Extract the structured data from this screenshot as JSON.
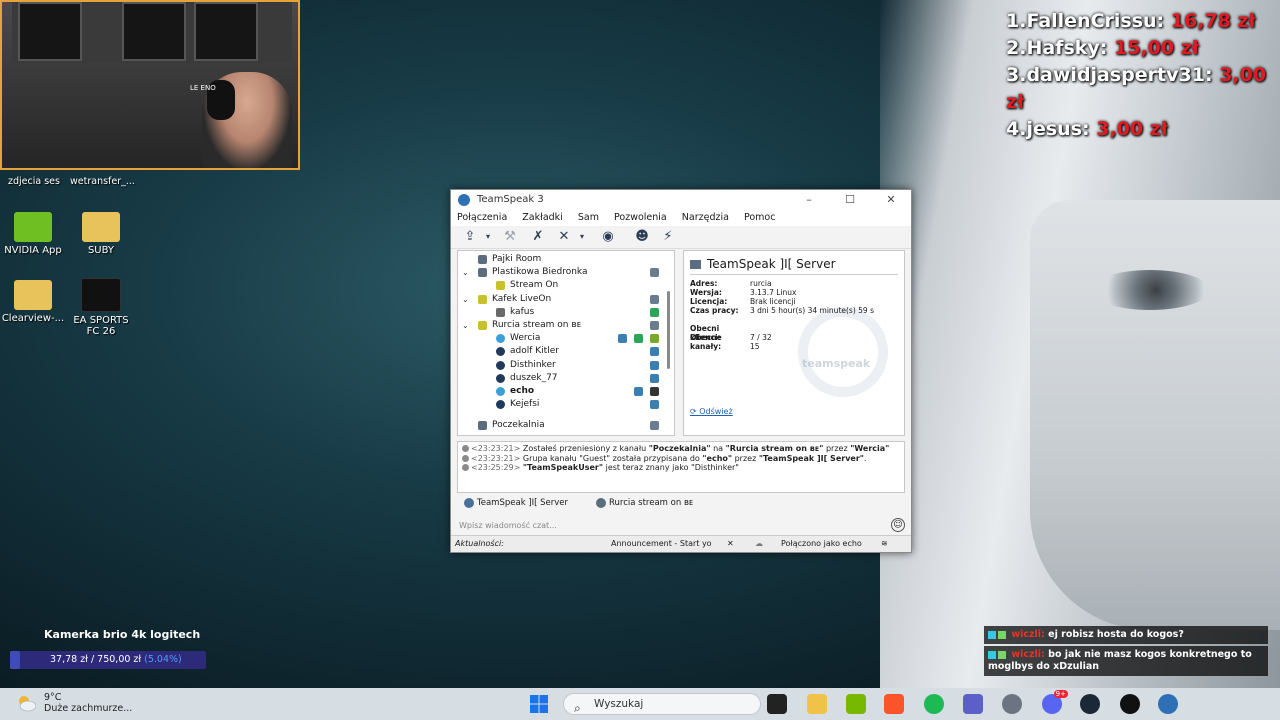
{
  "desktop": {
    "webcam_overlay": {
      "tag": "LE  ENO"
    },
    "file_labels": [
      "zdjecia ses",
      "wetransfer_..."
    ],
    "icons": [
      {
        "label": "NVIDIA App",
        "color": "#6fbf22"
      },
      {
        "label": "SUBY",
        "color": "#e8c25a"
      },
      {
        "label": "Clearview-...",
        "color": "#e8c25a"
      },
      {
        "label": "EA SPORTS FC 26",
        "color": "#111111"
      }
    ]
  },
  "donations": [
    {
      "rank": "1.",
      "name": "FallenCrissu:",
      "amount": "16,78 zł"
    },
    {
      "rank": "2.",
      "name": "Hafsky:",
      "amount": "15,00 zł"
    },
    {
      "rank": "3.",
      "name": "dawidjaspertv31:",
      "amount": "3,00 zł"
    },
    {
      "rank": "4.",
      "name": "jesus:",
      "amount": "3,00 zł"
    }
  ],
  "goal_widget": {
    "title": "Kamerka brio 4k logitech",
    "current": "37,78 zł",
    "separator": "/",
    "target": "750,00 zł",
    "percent": "(5.04%)",
    "fill_fraction": 0.0504
  },
  "stream_chat": [
    {
      "user": "wiczli:",
      "text": "ej robisz hosta do kogos?"
    },
    {
      "user": "wiczli:",
      "text": "bo jak nie masz kogos konkretnego to moglbys do xDzulian"
    }
  ],
  "teamspeak": {
    "title": "TeamSpeak 3",
    "window_buttons": [
      "–",
      "☐",
      "✕"
    ],
    "menu": [
      "Połączenia",
      "Zakładki",
      "Sam",
      "Pozwolenia",
      "Narzędzia",
      "Pomoc"
    ],
    "tree": [
      {
        "label": "Pajki Room",
        "indent": 24,
        "icon": "#5d6d80",
        "arrow": "",
        "bold": false
      },
      {
        "label": "Plastikowa Biedronka",
        "indent": 24,
        "icon": "#5d6d80",
        "arrow": "⌄",
        "bold": false
      },
      {
        "label": "Stream On",
        "indent": 42,
        "icon": "#c8c22a",
        "arrow": "",
        "bold": false
      },
      {
        "label": "Kafek LiveOn",
        "indent": 24,
        "icon": "#c8c22a",
        "arrow": "⌄",
        "bold": false
      },
      {
        "label": "kafus",
        "indent": 42,
        "icon": "#6a6a6a",
        "arrow": "",
        "bold": false
      },
      {
        "label": "Rurcia stream on ʙᴇ",
        "indent": 24,
        "icon": "#c8c22a",
        "arrow": "⌄",
        "bold": false
      },
      {
        "label": "Wercia",
        "indent": 42,
        "icon": "#3aa0d8",
        "arrow": "",
        "bold": false
      },
      {
        "label": "adolf Kitler",
        "indent": 42,
        "icon": "#1f3a5a",
        "arrow": "",
        "bold": false
      },
      {
        "label": "Disthinker",
        "indent": 42,
        "icon": "#1f3a5a",
        "arrow": "",
        "bold": false
      },
      {
        "label": "duszek_77",
        "indent": 42,
        "icon": "#1f3a5a",
        "arrow": "",
        "bold": false
      },
      {
        "label": "echo",
        "indent": 42,
        "icon": "#3aa0d8",
        "arrow": "",
        "bold": true
      },
      {
        "label": "Kejefsi",
        "indent": 42,
        "icon": "#1f3a5a",
        "arrow": "",
        "bold": false
      },
      {
        "label": "Poczekalnia",
        "indent": 24,
        "icon": "#5d6d80",
        "arrow": "",
        "bold": false
      }
    ],
    "server_info": {
      "header": "TeamSpeak ]I[ Server",
      "rows": [
        {
          "k": "Adres:",
          "v": "rurcia"
        },
        {
          "k": "Wersja:",
          "v": "3.13.7 Linux"
        },
        {
          "k": "Licencja:",
          "v": "Brak licencji"
        },
        {
          "k": "Czas pracy:",
          "v": "3 dni 5 hour(s) 34 minute(s) 59 s"
        },
        {
          "k": "",
          "v": ""
        },
        {
          "k": "Obecni klienci:",
          "v": "7 / 32"
        },
        {
          "k": "Obecne kanały:",
          "v": "15"
        }
      ],
      "watermark": "teamspeak",
      "refresh": "Odśwież"
    },
    "log": [
      {
        "time": "<23:23:21>",
        "pre": "Zostałeś przeniesiony z kanału ",
        "b1": "\"Poczekalnia\"",
        "mid": " na ",
        "b2": "\"Rurcia stream on ʙᴇ\"",
        "post": " przez ",
        "b3": "\"Wercia\""
      },
      {
        "time": "<23:23:21>",
        "pre": "Grupa kanału \"Guest\" została przypisana do ",
        "b1": "\"echo\"",
        "mid": " przez ",
        "b2": "\"TeamSpeak ]I[ Server\"",
        "post": ".",
        "b3": ""
      },
      {
        "time": "<23:25:29>",
        "pre": "",
        "b1": "\"TeamSpeakUser\"",
        "mid": " jest teraz znany jako ",
        "b2": "",
        "post": "\"Disthinker\"",
        "b3": ""
      }
    ],
    "tabs": [
      "TeamSpeak ]I[ Server",
      "Rurcia stream on ʙᴇ"
    ],
    "chat_placeholder": "Wpisz wiadomość czat...",
    "status": {
      "left": "Aktualności:",
      "announcement": "Announcement - Start yo",
      "connected": "Połączono jako echo"
    }
  },
  "taskbar": {
    "weather_temp": "9°C",
    "weather_desc": "Duże zachmurze...",
    "search_placeholder": "Wyszukaj",
    "discord_badge": "9+"
  }
}
